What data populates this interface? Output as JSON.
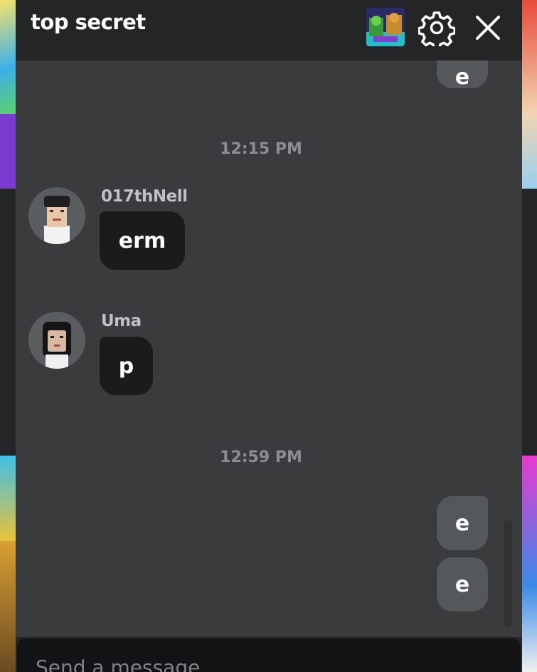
{
  "header": {
    "title": "top secret"
  },
  "messages": {
    "partial_top_text": "e",
    "timestamp_1": "12:15 PM",
    "msg_1": {
      "sender": "017thNell",
      "text": "erm"
    },
    "msg_2": {
      "sender": "Uma",
      "text": "p"
    },
    "timestamp_2": "12:59 PM",
    "out_1": {
      "text": "e"
    },
    "out_2": {
      "text": "e"
    }
  },
  "composer": {
    "placeholder": "Send a message"
  },
  "colors": {
    "panel": "#393b3d",
    "header": "#232527",
    "incoming_bubble": "#191b1d",
    "outgoing_bubble": "#55585b"
  }
}
